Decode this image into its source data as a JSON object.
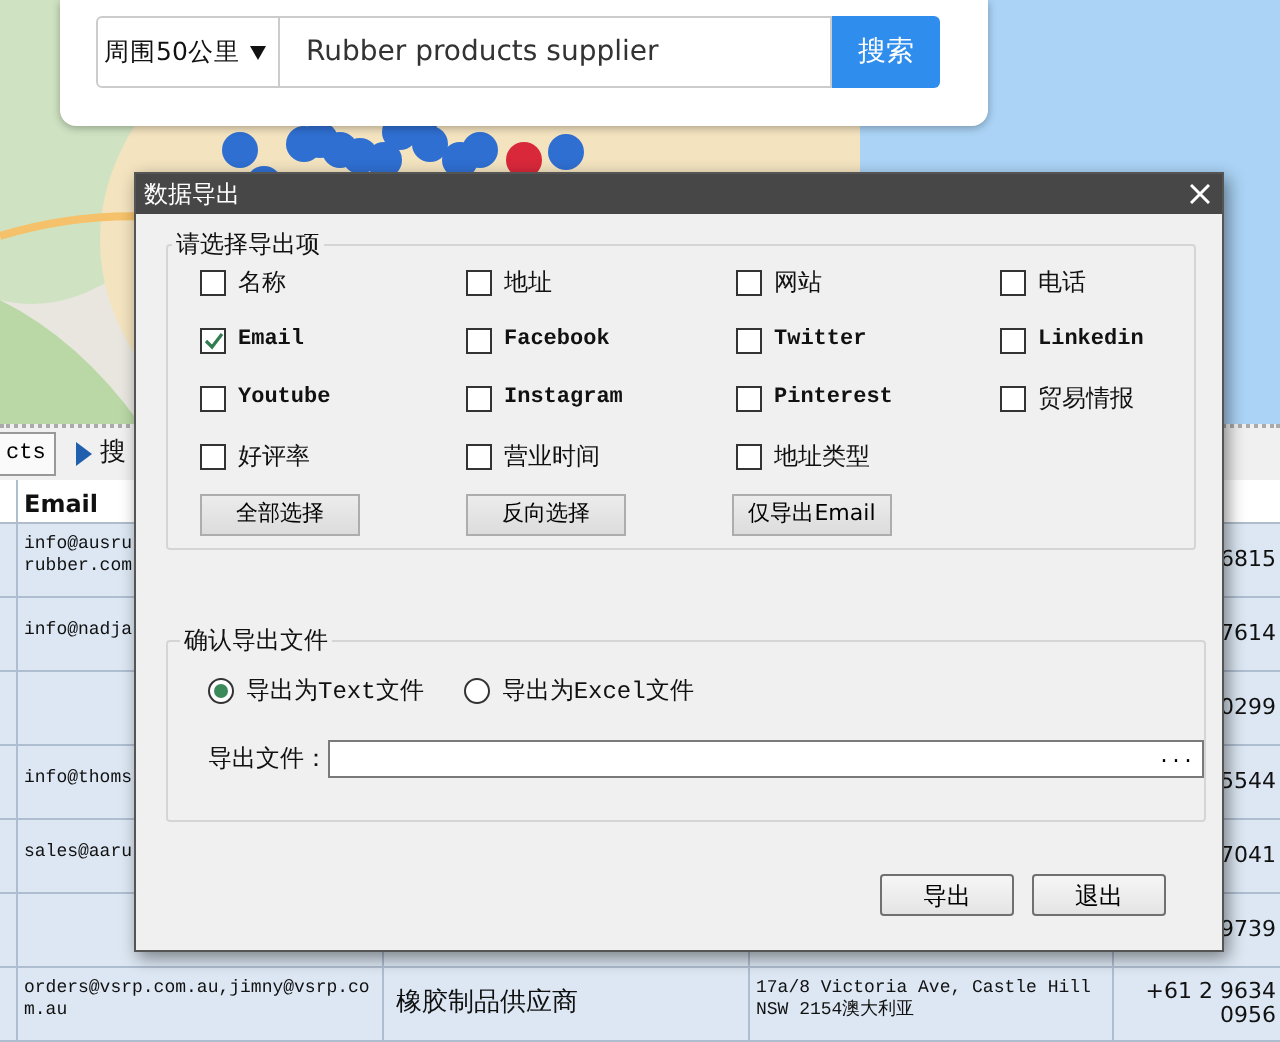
{
  "search_bar": {
    "radius": "周围50公里",
    "query": "Rubber products supplier",
    "button": "搜索"
  },
  "toolbar": {
    "button": "cts",
    "search_label": "搜"
  },
  "table": {
    "email_header": "Email",
    "rows": [
      {
        "email": [
          "info@ausru",
          "rubber.com"
        ],
        "phone": "6815"
      },
      {
        "email": [
          "info@nadja"
        ],
        "phone": "7614"
      },
      {
        "phone": "0299"
      },
      {
        "email": [
          "info@thoms"
        ],
        "phone": "5544"
      },
      {
        "email": [
          "sales@aaru"
        ],
        "phone": "7041"
      },
      {
        "phone": "9739"
      },
      {
        "email": [
          "orders@vsrp.com.au,jimny@vsrp.co",
          "m.au"
        ],
        "name": "橡胶制品供应商",
        "address": [
          "17a/8 Victoria Ave, Castle Hill",
          "NSW 2154澳大利亚"
        ],
        "phone": "+61 2 9634 0956"
      }
    ]
  },
  "dialog": {
    "title": "数据导出",
    "fields_title": "请选择导出项",
    "fields": [
      {
        "label": "名称",
        "checked": false
      },
      {
        "label": "地址",
        "checked": false
      },
      {
        "label": "网站",
        "checked": false
      },
      {
        "label": "电话",
        "checked": false
      },
      {
        "label": "Email",
        "checked": true
      },
      {
        "label": "Facebook",
        "checked": false
      },
      {
        "label": "Twitter",
        "checked": false
      },
      {
        "label": "Linkedin",
        "checked": false
      },
      {
        "label": "Youtube",
        "checked": false
      },
      {
        "label": "Instagram",
        "checked": false
      },
      {
        "label": "Pinterest",
        "checked": false
      },
      {
        "label": "贸易情报",
        "checked": false
      },
      {
        "label": "好评率",
        "checked": false
      },
      {
        "label": "营业时间",
        "checked": false
      },
      {
        "label": "地址类型",
        "checked": false
      }
    ],
    "select_buttons": [
      "全部选择",
      "反向选择",
      "仅导出Email"
    ],
    "file_title": "确认导出文件",
    "formats": [
      {
        "label": "导出为Text文件",
        "selected": true
      },
      {
        "label": "导出为Excel文件",
        "selected": false
      }
    ],
    "file_label": "导出文件：",
    "browse": "...",
    "buttons": [
      "导出",
      "退出"
    ]
  }
}
